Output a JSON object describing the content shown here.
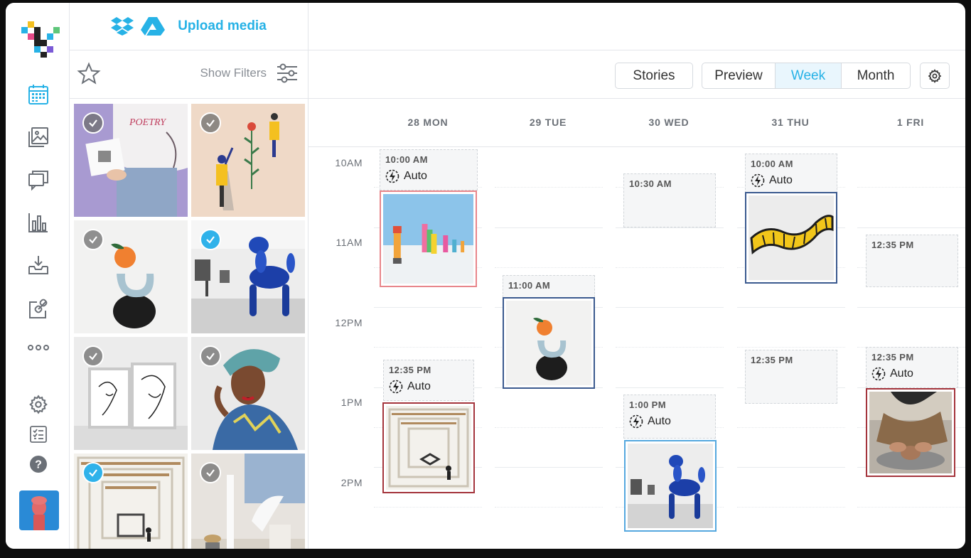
{
  "colors": {
    "accent": "#27b2e6",
    "border_pink": "#e8868b",
    "border_navy": "#3b5a8f",
    "border_maroon": "#a4343c",
    "border_lightblue": "#55a8df"
  },
  "media_panel": {
    "upload_label": "Upload media",
    "icons": [
      "dropbox-icon",
      "google-drive-icon"
    ],
    "show_filters_label": "Show Filters"
  },
  "media_grid": [
    {
      "name": "poetry-shirt-photo",
      "checked": false
    },
    {
      "name": "illustration-photo",
      "checked": false
    },
    {
      "name": "orange-sculpture-photo",
      "checked": false
    },
    {
      "name": "balloon-dog-gallery-photo",
      "checked": true
    },
    {
      "name": "line-art-frames-photo",
      "checked": false
    },
    {
      "name": "woman-turban-photo",
      "checked": false
    },
    {
      "name": "library-atrium-photo",
      "checked": true
    },
    {
      "name": "white-sculptures-photo",
      "checked": false
    }
  ],
  "toolbar": {
    "stories_label": "Stories",
    "preview_label": "Preview",
    "week_label": "Week",
    "month_label": "Month",
    "active_view": "Week"
  },
  "days": [
    "28 MON",
    "29 TUE",
    "30 WED",
    "31 THU",
    "1 FRI"
  ],
  "hours": [
    "10AM",
    "11AM",
    "12PM",
    "1PM",
    "2PM"
  ],
  "slots": {
    "mon_1000": {
      "time": "10:00 AM",
      "auto": "Auto"
    },
    "mon_1235": {
      "time": "12:35 PM",
      "auto": "Auto"
    },
    "tue_1100": {
      "time": "11:00 AM"
    },
    "wed_1030": {
      "time": "10:30 AM"
    },
    "wed_1300": {
      "time": "1:00 PM",
      "auto": "Auto"
    },
    "thu_1000": {
      "time": "10:00 AM",
      "auto": "Auto"
    },
    "thu_1235": {
      "time": "12:35 PM"
    },
    "fri_1235a": {
      "time": "12:35 PM"
    },
    "fri_1235b": {
      "time": "12:35 PM",
      "auto": "Auto"
    }
  }
}
